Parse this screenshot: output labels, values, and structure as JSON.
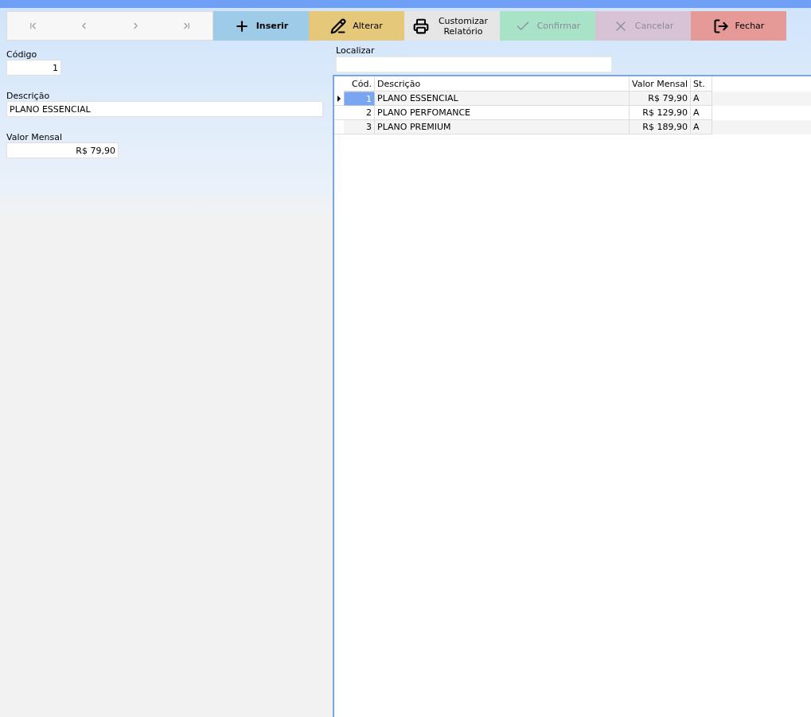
{
  "toolbar": {
    "actions": [
      {
        "kind": "insert",
        "label": "Inserir",
        "disabled": false
      },
      {
        "kind": "edit",
        "label": "Alterar",
        "disabled": false
      },
      {
        "kind": "print",
        "label": "Customizar Relatório",
        "disabled": false
      },
      {
        "kind": "confirm",
        "label": "Confirmar",
        "disabled": true
      },
      {
        "kind": "cancel",
        "label": "Cancelar",
        "disabled": true
      },
      {
        "kind": "close",
        "label": "Fechar",
        "disabled": false
      }
    ]
  },
  "form": {
    "fields": [
      {
        "label": "Código",
        "value": "1",
        "kind": "short"
      },
      {
        "label": "Descrição",
        "value": "PLANO ESSENCIAL",
        "kind": "wide"
      },
      {
        "label": "Valor Mensal",
        "value": "R$ 79,90",
        "kind": "money"
      }
    ]
  },
  "search": {
    "label": "Localizar"
  },
  "table": {
    "columns": [
      "Cód.",
      "Descrição",
      "Valor Mensal",
      "St."
    ],
    "rows": [
      {
        "selected": true,
        "cells": [
          "1",
          "PLANO ESSENCIAL",
          "R$ 79,90",
          "A"
        ]
      },
      {
        "selected": false,
        "cells": [
          "2",
          "PLANO PERFOMANCE",
          "R$ 129,90",
          "A"
        ]
      },
      {
        "selected": false,
        "cells": [
          "3",
          "PLANO PREMIUM",
          "R$ 189,90",
          "A"
        ]
      }
    ]
  }
}
